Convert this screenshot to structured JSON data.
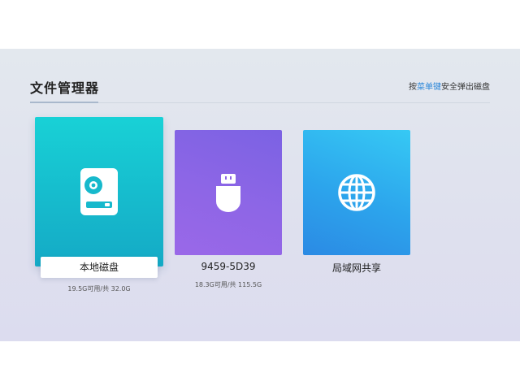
{
  "header": {
    "title": "文件管理器",
    "hint_prefix": "按",
    "hint_key": "菜单键",
    "hint_suffix": "安全弹出磁盘"
  },
  "colors": {
    "accent": "#2a86d8",
    "local_tile": "#16b9cc",
    "usb_tile": "#8e66e6",
    "share_tile": "#2ca4ec"
  },
  "devices": [
    {
      "name": "本地磁盘",
      "usage": "19.5G可用/共 32.0G",
      "icon": "hard-drive-icon",
      "focused": true
    },
    {
      "name": "9459-5D39",
      "usage": "18.3G可用/共 115.5G",
      "icon": "usb-drive-icon",
      "focused": false
    },
    {
      "name": "局域网共享",
      "usage": "",
      "icon": "globe-icon",
      "focused": false
    }
  ]
}
